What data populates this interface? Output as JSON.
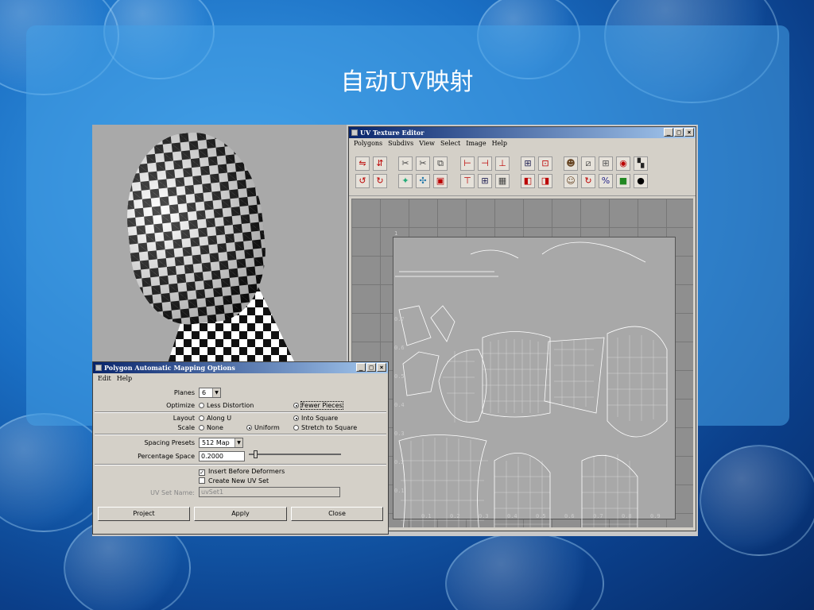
{
  "slide": {
    "title": "自动UV映射"
  },
  "uv_editor": {
    "title": "UV Texture Editor",
    "menu": [
      "Polygons",
      "Subdivs",
      "View",
      "Select",
      "Image",
      "Help"
    ],
    "ticks_x": [
      "0.1",
      "0.2",
      "0.3",
      "0.4",
      "0.5",
      "0.6",
      "0.7",
      "0.8",
      "0.9"
    ],
    "ticks_y": [
      "1",
      "0.7",
      "0.6",
      "0.5",
      "0.4",
      "0.3",
      "0.2",
      "0.1"
    ]
  },
  "options": {
    "title": "Polygon Automatic Mapping Options",
    "menu": [
      "Edit",
      "Help"
    ],
    "planes_label": "Planes",
    "planes_value": "6",
    "optimize_label": "Optimize",
    "optimize_opt1": "Less Distortion",
    "optimize_opt2": "Fewer Pieces",
    "layout_label": "Layout",
    "layout_opt1": "Along U",
    "layout_opt2": "Into Square",
    "scale_label": "Scale",
    "scale_opt1": "None",
    "scale_opt2": "Uniform",
    "scale_opt3": "Stretch to Square",
    "spacing_label": "Spacing Presets",
    "spacing_value": "512 Map",
    "percentage_label": "Percentage Space",
    "percentage_value": "0.2000",
    "insert_label": "Insert Before Deformers",
    "create_label": "Create New UV Set",
    "uvset_label": "UV Set Name:",
    "uvset_value": "uvSet1",
    "btn_project": "Project",
    "btn_apply": "Apply",
    "btn_close": "Close"
  },
  "window_buttons": {
    "min": "_",
    "max": "□",
    "close": "×"
  }
}
